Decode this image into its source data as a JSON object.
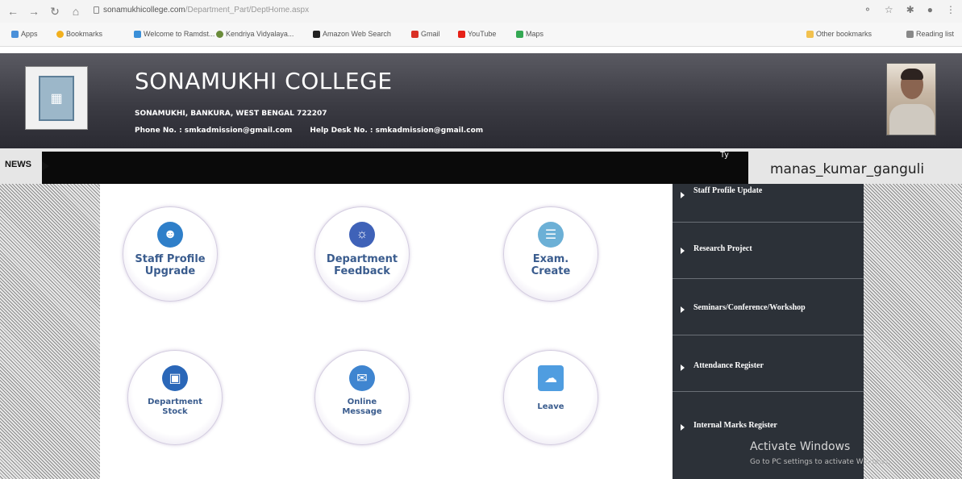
{
  "browser": {
    "url_domain": "sonamukhicollege.com",
    "url_path": "/Department_Part/DeptHome.aspx",
    "bookmarks": [
      {
        "label": "Apps",
        "color": "#4a90d9"
      },
      {
        "label": "Bookmarks",
        "color": "#f2b01e"
      },
      {
        "label": "Welcome to Ramdst...",
        "color": "#3a8fd8"
      },
      {
        "label": "Kendriya Vidyalaya...",
        "color": "#6a8b3a"
      },
      {
        "label": "Amazon Web Search",
        "color": "#222222"
      },
      {
        "label": "Gmail",
        "color": "#d93025"
      },
      {
        "label": "YouTube",
        "color": "#e62117"
      },
      {
        "label": "Maps",
        "color": "#34a853"
      }
    ],
    "other_bookmarks": "Other bookmarks",
    "reading_list": "Reading list"
  },
  "header": {
    "title": "SONAMUKHI COLLEGE",
    "address": "SONAMUKHI, BANKURA, WEST BENGAL 722207",
    "phone": "Phone No. : smkadmission@gmail.com",
    "helpdesk": "Help Desk No. : smkadmission@gmail.com"
  },
  "news": {
    "label": "NEWS",
    "ticker": "Ty"
  },
  "user": {
    "name": "manas_kumar_ganguli"
  },
  "tiles": [
    {
      "label_line1": "Staff Profile",
      "label_line2": "Upgrade",
      "icon": "person-icon",
      "icon_color": "#2f7fc9"
    },
    {
      "label_line1": "Department",
      "label_line2": "Feedback",
      "icon": "people-icon",
      "icon_color": "#3f62b8"
    },
    {
      "label_line1": "Exam.",
      "label_line2": "Create",
      "icon": "document-icon",
      "icon_color": "#6cb0d6"
    },
    {
      "label_line1": "Department",
      "label_line2": "Stock",
      "icon": "box-icon",
      "icon_color": "#2a67b8"
    },
    {
      "label_line1": "Online",
      "label_line2": "Message",
      "icon": "envelope-icon",
      "icon_color": "#3f85d0"
    },
    {
      "label_line1": "Leave",
      "label_line2": "",
      "icon": "calendar-icon",
      "icon_color": "#4f9de0"
    }
  ],
  "sidebar": {
    "items": [
      {
        "label": "Staff Profile Update"
      },
      {
        "label": "Research Project"
      },
      {
        "label": "Seminars/Conference/Workshop"
      },
      {
        "label": "Attendance Register"
      },
      {
        "label": "Internal Marks Register"
      }
    ]
  },
  "watermark": {
    "line1": "Activate Windows",
    "line2": "Go to PC settings to activate Windows."
  }
}
